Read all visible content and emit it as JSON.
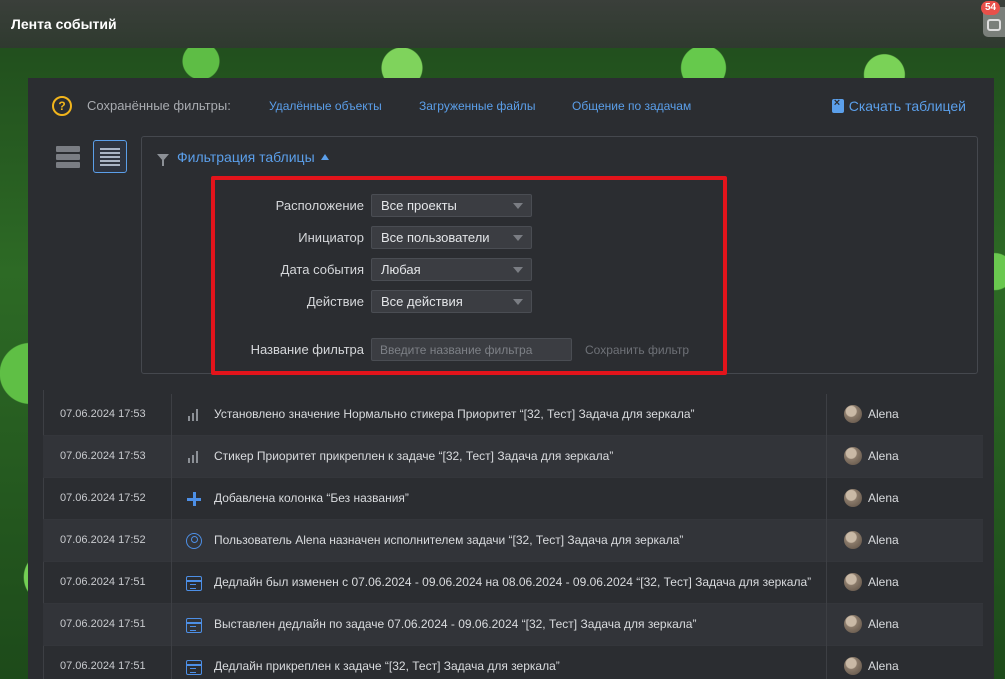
{
  "window": {
    "title": "Лента событий",
    "notification_count": "54"
  },
  "header": {
    "saved_filters_label": "Сохранённые фильтры:",
    "saved_filters": [
      "Удалённые объекты",
      "Загруженные файлы",
      "Общение по задачам"
    ],
    "download_label": "Скачать таблицей"
  },
  "filter": {
    "toggle_label": "Фильтрация таблицы",
    "fields": [
      {
        "label": "Расположение",
        "value": "Все проекты"
      },
      {
        "label": "Инициатор",
        "value": "Все пользователи"
      },
      {
        "label": "Дата события",
        "value": "Любая"
      },
      {
        "label": "Действие",
        "value": "Все действия"
      }
    ],
    "name_label": "Название фильтра",
    "name_placeholder": "Введите название фильтра",
    "save_label": "Сохранить фильтр"
  },
  "events": [
    {
      "time": "07.06.2024 17:53",
      "icon": "bars-icon",
      "message": "Установлено значение Нормально стикера Приоритет “[32, Тест] Задача для зеркала”",
      "user": "Alena"
    },
    {
      "time": "07.06.2024 17:53",
      "icon": "bars-icon",
      "message": "Стикер Приоритет прикреплен к задаче “[32, Тест] Задача для зеркала”",
      "user": "Alena"
    },
    {
      "time": "07.06.2024 17:52",
      "icon": "plus-icon",
      "message": "Добавлена колонка “Без названия”",
      "user": "Alena"
    },
    {
      "time": "07.06.2024 17:52",
      "icon": "assign-icon",
      "message": "Пользователь Alena назначен исполнителем задачи “[32, Тест] Задача для зеркала”",
      "user": "Alena"
    },
    {
      "time": "07.06.2024 17:51",
      "icon": "calendar-icon",
      "message": "Дедлайн был изменен с 07.06.2024 - 09.06.2024 на 08.06.2024 - 09.06.2024 “[32, Тест] Задача для зеркала”",
      "user": "Alena"
    },
    {
      "time": "07.06.2024 17:51",
      "icon": "calendar-icon",
      "message": "Выставлен дедлайн по задаче 07.06.2024 - 09.06.2024 “[32, Тест] Задача для зеркала”",
      "user": "Alena"
    },
    {
      "time": "07.06.2024 17:51",
      "icon": "calendar-icon",
      "message": "Дедлайн прикреплен к задаче “[32, Тест] Задача для зеркала”",
      "user": "Alena"
    }
  ],
  "colors": {
    "accent": "#5b9fea",
    "highlight_frame": "#e3141b",
    "help": "#f2b51c",
    "badge": "#e8504a"
  }
}
